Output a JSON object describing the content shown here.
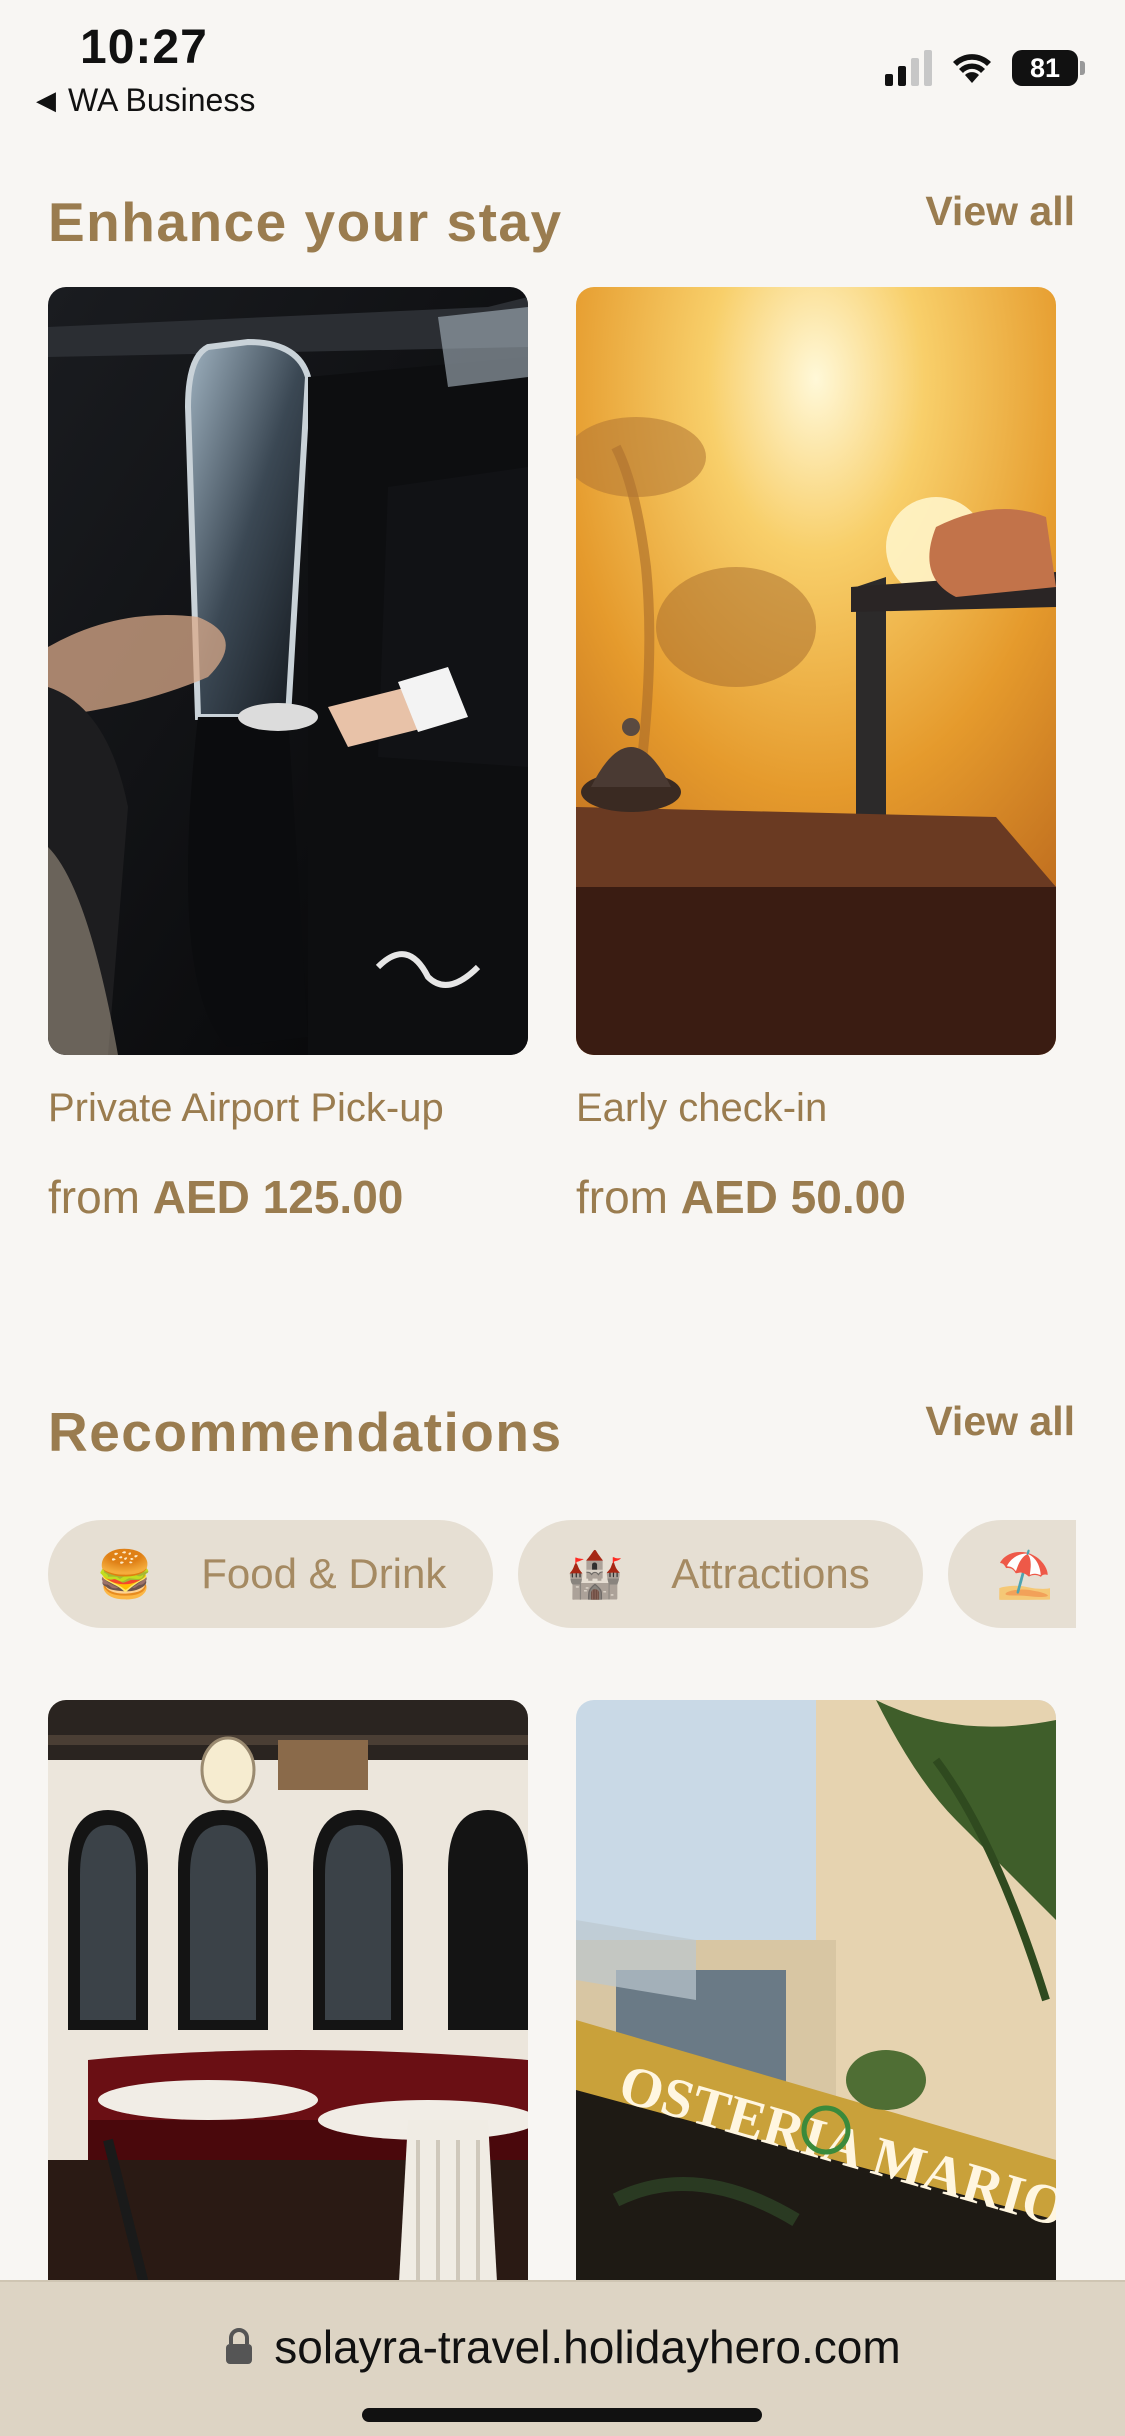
{
  "status_bar": {
    "time": "10:27",
    "back_app": "WA Business",
    "battery": "81"
  },
  "enhance": {
    "title": "Enhance your stay",
    "view_all": "View all",
    "items": [
      {
        "title": "Private Airport Pick-up",
        "price_prefix": "from",
        "price": "AED 125.00",
        "image": "car-door-photo"
      },
      {
        "title": "Early check-in",
        "price_prefix": "from",
        "price": "AED 50.00",
        "image": "hotel-bell-luggage-photo"
      }
    ]
  },
  "recommendations": {
    "title": "Recommendations",
    "view_all": "View all",
    "chips": [
      {
        "emoji": "🍔",
        "label": "Food & Drink"
      },
      {
        "emoji": "🏰",
        "label": "Attractions"
      },
      {
        "emoji": "⛱️",
        "label": ""
      }
    ],
    "cards": [
      {
        "image": "restaurant-interior-photo"
      },
      {
        "image": "osteria-mario-photo",
        "sign_text": "OSTERIA MARIO"
      }
    ]
  },
  "browser": {
    "url": "solayra-travel.holidayhero.com",
    "lock_icon": "lock-icon"
  }
}
